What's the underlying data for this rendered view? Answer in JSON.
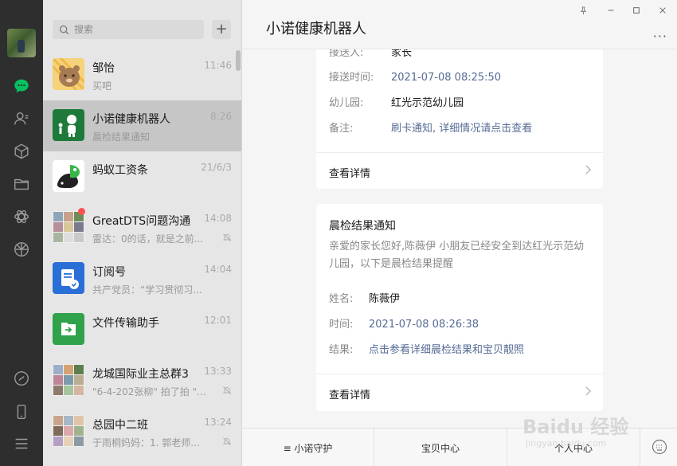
{
  "sidebar": {
    "icons": [
      "chat-icon",
      "contacts-icon",
      "collections-icon",
      "files-icon",
      "miniprogram-icon",
      "moments-icon",
      "channels-icon",
      "phone-icon",
      "menu-icon"
    ]
  },
  "search": {
    "placeholder": "搜索"
  },
  "add_button": "+",
  "chats": [
    {
      "name": "邹怡",
      "preview": "买吧",
      "time": "11:46"
    },
    {
      "name": "小诺健康机器人",
      "preview": "晨检结果通知",
      "time": "8:26"
    },
    {
      "name": "蚂蚁工资条",
      "preview": "",
      "time": "21/6/3"
    },
    {
      "name": "GreatDTS问题沟通",
      "preview": "雷达：0的话，就是之前...",
      "time": "14:08"
    },
    {
      "name": "订阅号",
      "preview": "共产党员：“学习贯彻习...",
      "time": "14:04"
    },
    {
      "name": "文件传输助手",
      "preview": "",
      "time": "12:01"
    },
    {
      "name": "龙城国际业主总群3",
      "preview": "\"6-4-202张柳\" 拍了拍 \"...",
      "time": "13:33"
    },
    {
      "name": "总园中二班",
      "preview": "于雨桐妈妈：1. 郭老师...",
      "time": "13:24"
    }
  ],
  "window": {
    "pin": "⊥",
    "minimize": "—",
    "maximize": "□",
    "close": "✕"
  },
  "conversation": {
    "title": "小诺健康机器人",
    "more": "···",
    "card1": {
      "partial_label": "接送人:",
      "partial_value": "家长",
      "rows": [
        {
          "label": "接送时间:",
          "value": "2021-07-08 08:25:50"
        },
        {
          "label": "幼儿园:",
          "value": "红光示范幼儿园"
        },
        {
          "label": "备注:",
          "value": "刷卡通知, 详细情况请点击查看"
        }
      ],
      "detail": "查看详情"
    },
    "card2": {
      "title": "晨检结果通知",
      "description": "亲爱的家长您好,陈薇伊 小朋友已经安全到达红光示范幼儿园，以下是晨检结果提醒",
      "rows": [
        {
          "label": "姓名:",
          "value": "陈薇伊"
        },
        {
          "label": "时间:",
          "value": "2021-07-08 08:26:38"
        },
        {
          "label": "结果:",
          "value": "点击参看详细晨检结果和宝贝靓照"
        }
      ],
      "detail": "查看详情"
    }
  },
  "bottom_menu": [
    "≡ 小诺守护",
    "宝贝中心",
    "个人中心"
  ],
  "watermark": {
    "brand": "Baidu 经验",
    "sub": "jingyan.baidu.com"
  },
  "colors": {
    "accent": "#07c160",
    "link": "#576b95",
    "rail": "#2e2e2e"
  }
}
